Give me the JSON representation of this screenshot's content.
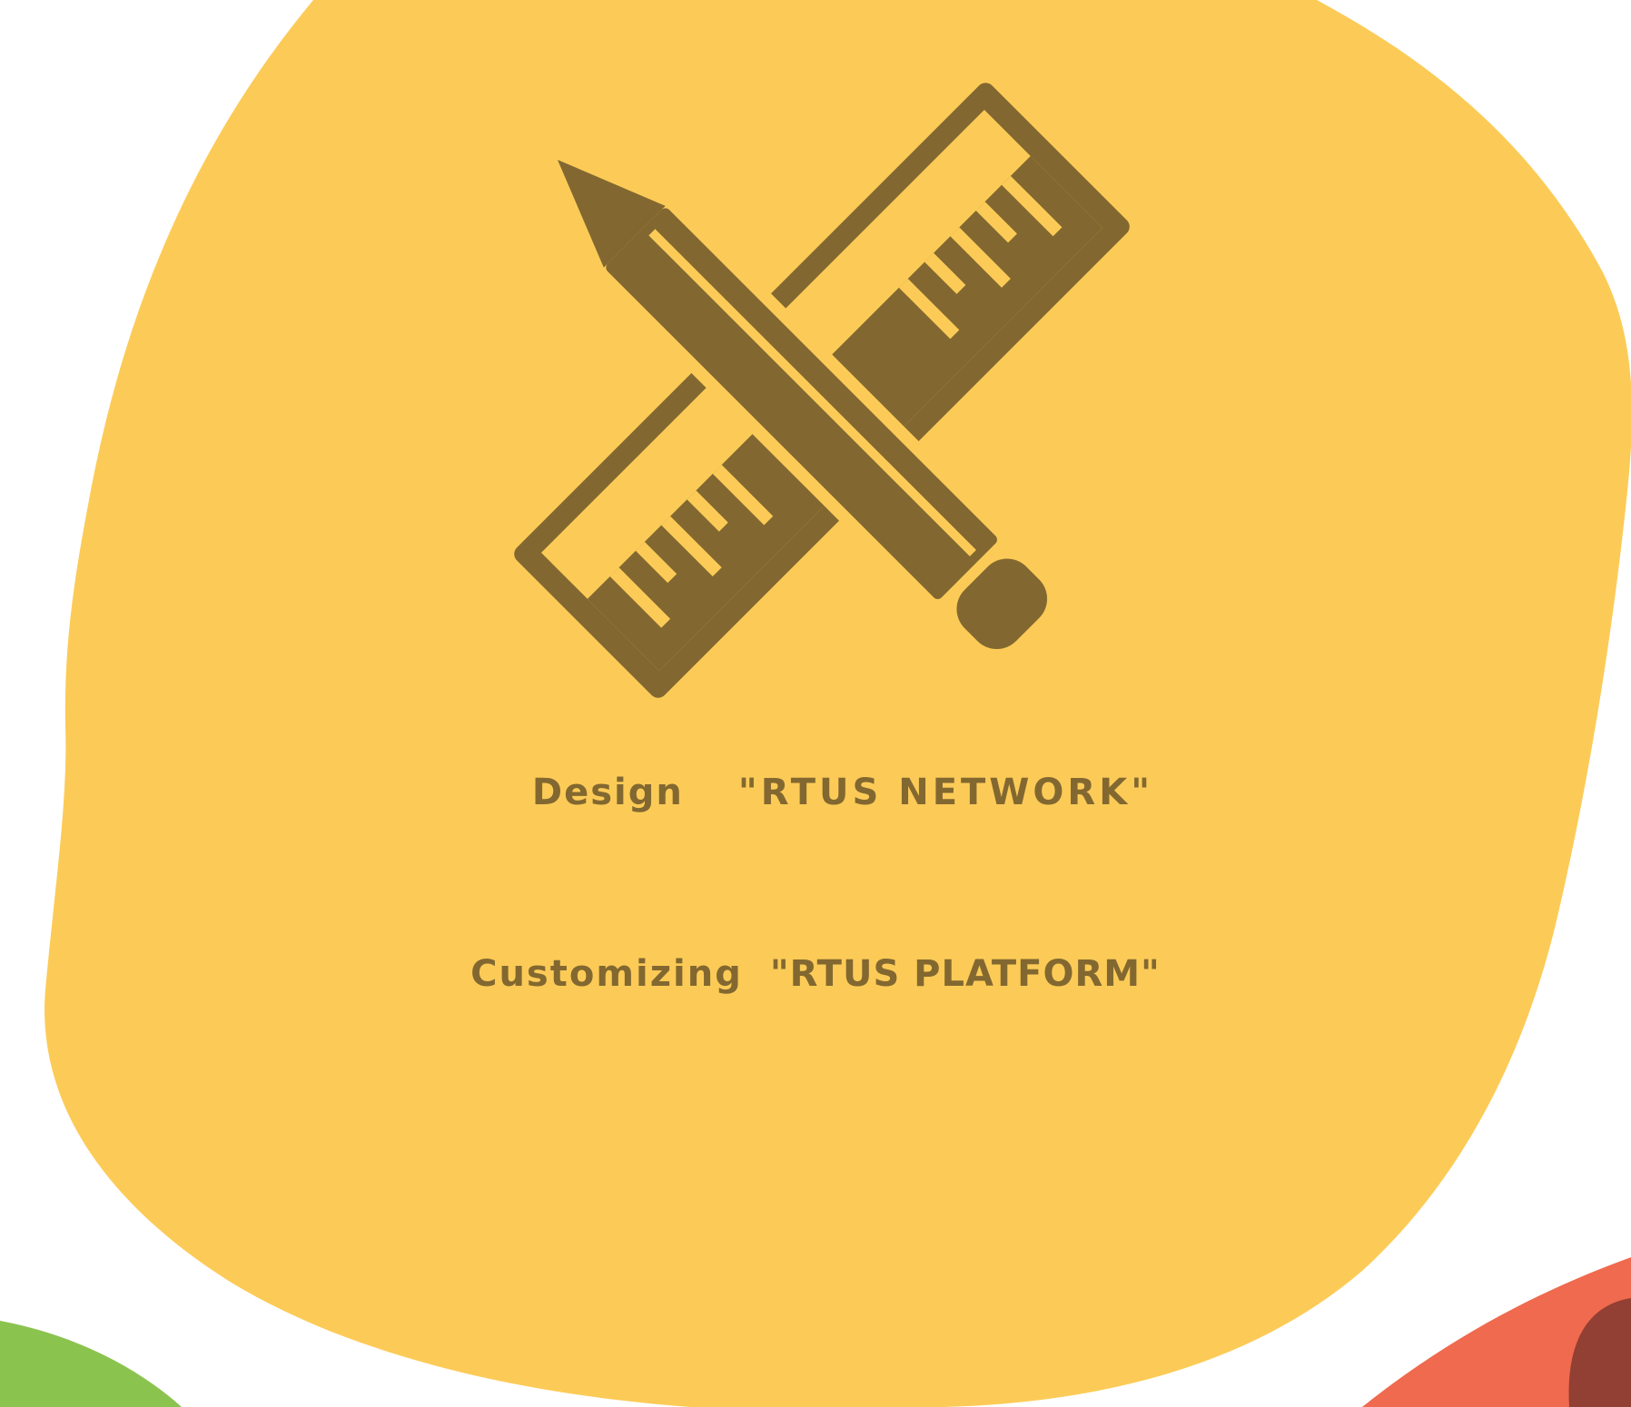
{
  "colors": {
    "background": "#ffffff",
    "blob_yellow": "#fccb57",
    "ink_brown": "#826830",
    "corner_green": "#8bc34f",
    "corner_orange": "#ef6a4e",
    "corner_dark_red": "#923f34"
  },
  "icon": {
    "name": "pencil-and-ruler-icon"
  },
  "headline": {
    "line1_lead": "Design",
    "line1_quoted": "\"RTUS NETWORK\"",
    "line2_lead": "Customizing",
    "line2_quoted": "\"RTUS PLATFORM\""
  }
}
